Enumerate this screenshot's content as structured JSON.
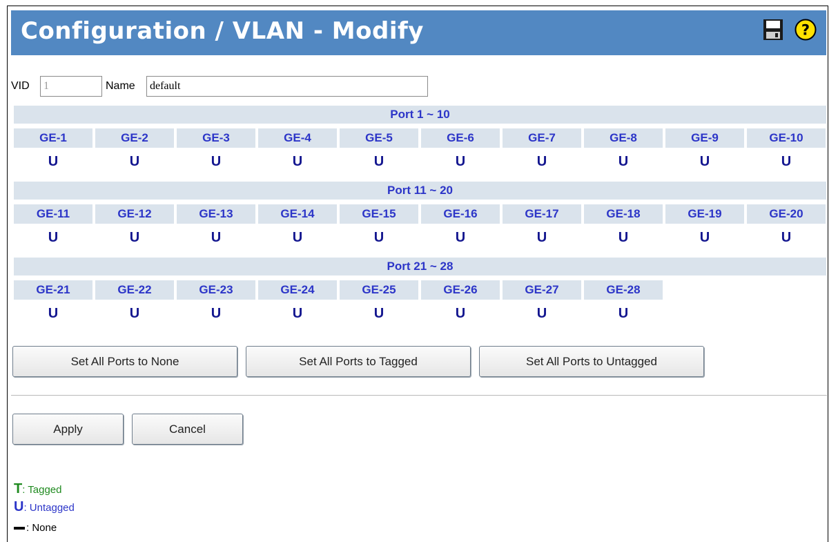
{
  "header": {
    "title": "Configuration / VLAN - Modify",
    "save_icon": "save-icon",
    "help_icon": "help-icon"
  },
  "form": {
    "vid_label": "VID",
    "vid_value": "1",
    "name_label": "Name",
    "name_value": "default"
  },
  "sections": [
    {
      "header": "Port 1 ~ 10",
      "ports": [
        {
          "label": "GE-1",
          "value": "U"
        },
        {
          "label": "GE-2",
          "value": "U"
        },
        {
          "label": "GE-3",
          "value": "U"
        },
        {
          "label": "GE-4",
          "value": "U"
        },
        {
          "label": "GE-5",
          "value": "U"
        },
        {
          "label": "GE-6",
          "value": "U"
        },
        {
          "label": "GE-7",
          "value": "U"
        },
        {
          "label": "GE-8",
          "value": "U"
        },
        {
          "label": "GE-9",
          "value": "U"
        },
        {
          "label": "GE-10",
          "value": "U"
        }
      ]
    },
    {
      "header": "Port 11 ~ 20",
      "ports": [
        {
          "label": "GE-11",
          "value": "U"
        },
        {
          "label": "GE-12",
          "value": "U"
        },
        {
          "label": "GE-13",
          "value": "U"
        },
        {
          "label": "GE-14",
          "value": "U"
        },
        {
          "label": "GE-15",
          "value": "U"
        },
        {
          "label": "GE-16",
          "value": "U"
        },
        {
          "label": "GE-17",
          "value": "U"
        },
        {
          "label": "GE-18",
          "value": "U"
        },
        {
          "label": "GE-19",
          "value": "U"
        },
        {
          "label": "GE-20",
          "value": "U"
        }
      ]
    },
    {
      "header": "Port 21 ~ 28",
      "ports": [
        {
          "label": "GE-21",
          "value": "U"
        },
        {
          "label": "GE-22",
          "value": "U"
        },
        {
          "label": "GE-23",
          "value": "U"
        },
        {
          "label": "GE-24",
          "value": "U"
        },
        {
          "label": "GE-25",
          "value": "U"
        },
        {
          "label": "GE-26",
          "value": "U"
        },
        {
          "label": "GE-27",
          "value": "U"
        },
        {
          "label": "GE-28",
          "value": "U"
        }
      ]
    }
  ],
  "bulk_buttons": {
    "none_label": "Set All Ports to None",
    "tagged_label": "Set All Ports to Tagged",
    "untagged_label": "Set All Ports to Untagged"
  },
  "actions": {
    "apply_label": "Apply",
    "cancel_label": "Cancel"
  },
  "legend": {
    "tagged_symbol": "T",
    "tagged_text": ": Tagged",
    "untagged_symbol": "U",
    "untagged_text": ": Untagged",
    "none_text": ": None"
  },
  "colors": {
    "header_bg": "#5288c2",
    "port_text": "#2c35c8",
    "cell_bg": "#dae3ec",
    "tagged": "#1f8a1f"
  }
}
